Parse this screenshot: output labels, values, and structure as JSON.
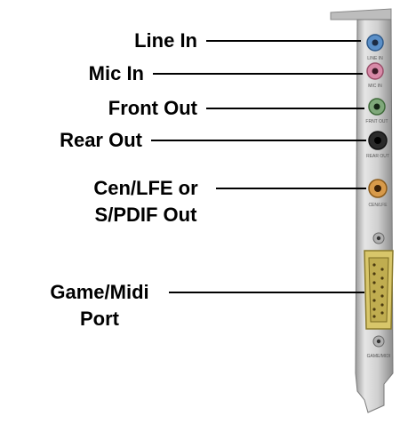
{
  "labels": {
    "line_in": "Line In",
    "mic_in": "Mic In",
    "front_out": "Front Out",
    "rear_out": "Rear Out",
    "cen_lfe_line1": "Cen/LFE or",
    "cen_lfe_line2": "S/PDIF Out",
    "game_line1": "Game/Midi",
    "game_line2": "Port"
  },
  "bracket_text": {
    "line_in": "LINE IN",
    "mic_in": "MIC IN",
    "front_out": "FRNT OUT",
    "rear_out": "REAR OUT",
    "cen_lfe": "CEN/LFE",
    "game": "GAME/MIDI"
  },
  "colors": {
    "line_in_jack": "#5a8fc8",
    "mic_in_jack": "#d88aa8",
    "front_out_jack": "#7fa87a",
    "rear_out_jack": "#2a2a2a",
    "cen_lfe_jack": "#d89a4a",
    "game_port": "#d8c66a",
    "bracket": "#c9c9c9"
  }
}
